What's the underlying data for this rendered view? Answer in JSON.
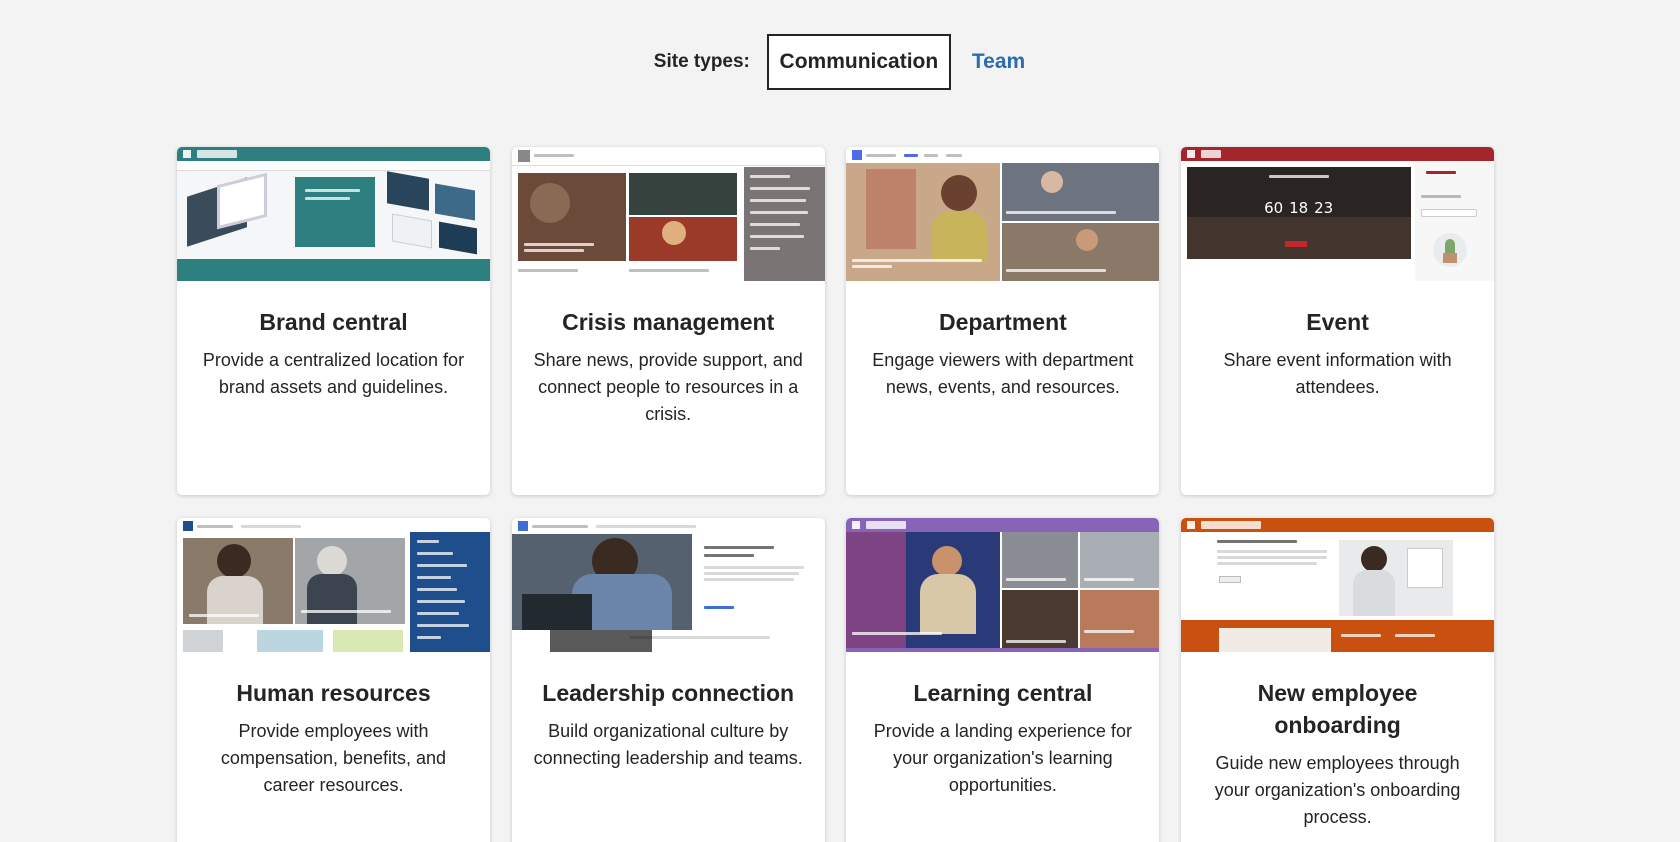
{
  "site_types": {
    "label": "Site types:",
    "tabs": [
      "Communication",
      "Team"
    ],
    "selected": "Communication"
  },
  "cards": [
    {
      "title": "Brand central",
      "description": "Provide a centralized location for brand assets and guidelines."
    },
    {
      "title": "Crisis management",
      "description": "Share news, provide support, and connect people to resources in a crisis."
    },
    {
      "title": "Department",
      "description": "Engage viewers with department news, events, and resources."
    },
    {
      "title": "Event",
      "description": "Share event information with attendees."
    },
    {
      "title": "Human resources",
      "description": "Provide employees with compensation, benefits, and career resources."
    },
    {
      "title": "Leadership connection",
      "description": "Build organizational culture by connecting leadership and teams."
    },
    {
      "title": "Learning central",
      "description": "Provide a landing experience for your organization's learning opportunities."
    },
    {
      "title": "New employee onboarding",
      "description": "Guide new employees through your organization's onboarding process."
    }
  ],
  "event_countdown": {
    "days": "60",
    "hours": "18",
    "minutes": "23"
  },
  "colors": {
    "brand_central": "#2e7f80",
    "crisis": "#7a7474",
    "department": "#4f6bed",
    "event": "#a4262c",
    "human_resources": "#1f4e8c",
    "leadership": "#ffffff",
    "learning": "#8764b8",
    "onboarding": "#ca5010",
    "team_link": "#2b6cb0"
  }
}
